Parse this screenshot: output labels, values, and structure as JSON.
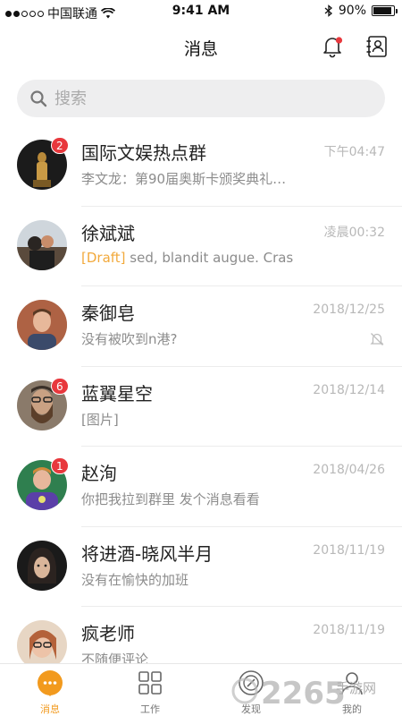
{
  "status_bar": {
    "carrier": "中国联通",
    "time": "9:41 AM",
    "battery": "90%"
  },
  "nav": {
    "title": "消息"
  },
  "search": {
    "placeholder": "搜索"
  },
  "conversations": [
    {
      "name": "国际文娱热点群",
      "time": "下午04:47",
      "preview": "李文龙：第90届奥斯卡颁奖典礼…",
      "badge": "2",
      "draft_tag": "",
      "muted": false
    },
    {
      "name": "徐斌斌",
      "time": "凌晨00:32",
      "preview": " sed, blandit augue. Cras",
      "badge": "",
      "draft_tag": "[Draft]",
      "muted": false
    },
    {
      "name": "秦御皂",
      "time": "2018/12/25",
      "preview": "没有被吹到n港?",
      "badge": "",
      "draft_tag": "",
      "muted": true
    },
    {
      "name": "蓝翼星空",
      "time": "2018/12/14",
      "preview": "[图片]",
      "badge": "6",
      "draft_tag": "",
      "muted": false
    },
    {
      "name": "赵洵",
      "time": "2018/04/26",
      "preview": "你把我拉到群里 发个消息看看",
      "badge": "1",
      "draft_tag": "",
      "muted": false
    },
    {
      "name": "将进酒-晓风半月",
      "time": "2018/11/19",
      "preview": "没有在愉快的加班",
      "badge": "",
      "draft_tag": "",
      "muted": false
    },
    {
      "name": "疯老师",
      "time": "2018/11/19",
      "preview": "不随便评论",
      "badge": "",
      "draft_tag": "",
      "muted": false
    }
  ],
  "tabs": [
    {
      "label": "消息",
      "icon": "chat-bubble-icon",
      "active": true
    },
    {
      "label": "工作",
      "icon": "grid-icon",
      "active": false
    },
    {
      "label": "发现",
      "icon": "compass-icon",
      "active": false
    },
    {
      "label": "我的",
      "icon": "person-icon",
      "active": false
    }
  ],
  "watermark": {
    "brand": "2265",
    "site": "手游网"
  },
  "colors": {
    "accent": "#f29a1e",
    "badge": "#e8383d",
    "draft": "#f2a93b"
  }
}
